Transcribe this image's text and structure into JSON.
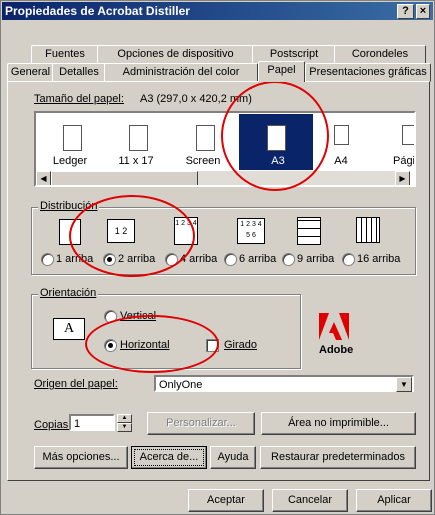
{
  "window": {
    "title": "Propiedades de Acrobat Distiller",
    "help_glyph": "?",
    "close_glyph": "×"
  },
  "tabs_back": [
    "Fuentes",
    "Opciones de dispositivo",
    "Postscript",
    "Corondeles"
  ],
  "tabs_front": [
    "General",
    "Detalles",
    "Administración del color",
    "Papel",
    "Presentaciones gráficas"
  ],
  "active_tab": "Papel",
  "paper": {
    "label": "Tamaño del papel:",
    "value": "A3 (297,0 x 420,2 mm)",
    "items": [
      "Ledger",
      "11 x 17",
      "Screen",
      "A3",
      "A4",
      "Pági"
    ],
    "selected": "A3"
  },
  "distribution": {
    "title": "Distribución",
    "icon_labels": [
      "1 2",
      "1 2 3 4",
      "1 2 3 4 5 6"
    ],
    "options": [
      "1 arriba",
      "2 arriba",
      "4 arriba",
      "6 arriba",
      "9 arriba",
      "16 arriba"
    ],
    "selected": "2 arriba"
  },
  "orientation": {
    "title": "Orientación",
    "preview_letter": "A",
    "options": [
      "Vertical",
      "Horizontal"
    ],
    "selected": "Horizontal",
    "rotated_label": "Girado",
    "brand": "Adobe"
  },
  "source": {
    "label": "Origen del papel:",
    "value": "OnlyOne"
  },
  "copies": {
    "label": "Copias:",
    "value": "1"
  },
  "buttons": {
    "customize": "Personalizar...",
    "printable_area": "Área no imprimible...",
    "more_options": "Más opciones...",
    "about": "Acerca de...",
    "help": "Ayuda",
    "restore": "Restaurar predeterminados",
    "ok": "Aceptar",
    "cancel": "Cancelar",
    "apply": "Aplicar"
  },
  "annotation_color": "#e00000"
}
